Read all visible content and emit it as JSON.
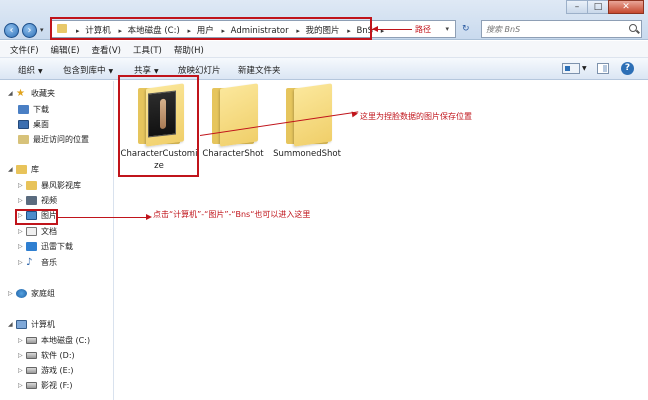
{
  "address": {
    "crumbs": [
      "计算机",
      "本地磁盘 (C:)",
      "用户",
      "Administrator",
      "我的图片",
      "BnS"
    ],
    "search_placeholder": "搜索 BnS"
  },
  "menu": [
    "文件(F)",
    "编辑(E)",
    "查看(V)",
    "工具(T)",
    "帮助(H)"
  ],
  "toolbar": {
    "organize": "组织",
    "include_library": "包含到库中",
    "share": "共享",
    "slideshow": "放映幻灯片",
    "new_folder": "新建文件夹"
  },
  "nav": {
    "favorites": "收藏夹",
    "downloads": "下载",
    "desktop": "桌面",
    "recent": "最近访问的位置",
    "libraries": "库",
    "storm": "暴风影视库",
    "videos": "视频",
    "pictures": "图片",
    "documents": "文档",
    "xunlei": "迅雷下载",
    "music": "音乐",
    "homegroup": "家庭组",
    "computer": "计算机",
    "drive_c": "本地磁盘 (C:)",
    "drive_d": "软件 (D:)",
    "drive_e": "游戏 (E:)",
    "drive_f": "影视 (F:)"
  },
  "files": [
    {
      "name": "CharacterCustomize"
    },
    {
      "name": "CharacterShot"
    },
    {
      "name": "SummonedShot"
    }
  ],
  "annotations": {
    "path": "路径",
    "folder": "这里为捏脸数据的图片保存位置",
    "sidebar": "点击“计算机”-“图片”-“Bns“也可以进入这里"
  },
  "colors": {
    "annotation_red": "#c0141b",
    "accent": "#2d6fb6"
  }
}
